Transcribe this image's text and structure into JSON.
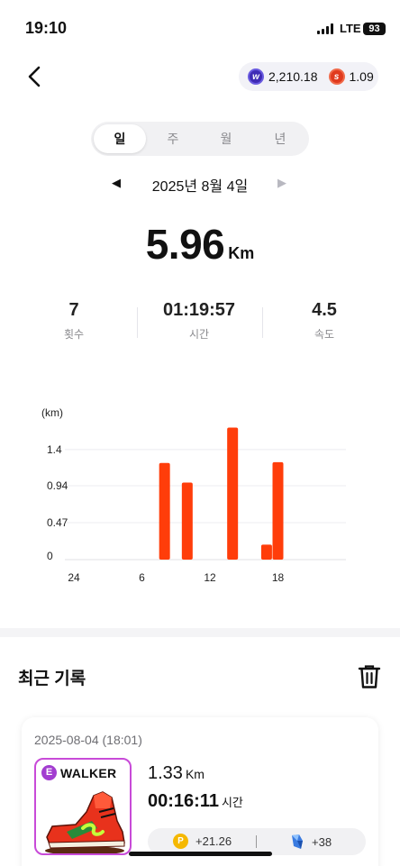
{
  "status_bar": {
    "time": "19:10",
    "network": "LTE",
    "battery": "93"
  },
  "header": {
    "balances": [
      {
        "icon": "w-token-icon",
        "value": "2,210.18",
        "color": "#3f2bb5"
      },
      {
        "icon": "s-token-icon",
        "value": "1.09",
        "color": "#e03a1e"
      }
    ]
  },
  "period_tabs": [
    "일",
    "주",
    "월",
    "년"
  ],
  "active_tab": "일",
  "date": {
    "label": "2025년 8월 4일",
    "prev_icon": "◀",
    "next_icon": "▶"
  },
  "summary": {
    "distance": "5.96",
    "distance_unit": "Km",
    "stats": [
      {
        "value": "7",
        "label": "횟수"
      },
      {
        "value": "01:19:57",
        "label": "시간"
      },
      {
        "value": "4.5",
        "label": "속도"
      }
    ]
  },
  "chart_data": {
    "type": "bar",
    "ylabel": "(km)",
    "y_ticks": [
      "0",
      "0.47",
      "0.94",
      "1.4"
    ],
    "x_ticks": [
      "24",
      "6",
      "12",
      "18"
    ],
    "xlim": [
      0,
      24
    ],
    "ylim": [
      0,
      1.41
    ],
    "grid": true,
    "bar_color": "#ff3d0a",
    "x": [
      8,
      10,
      14,
      17,
      18
    ],
    "values": [
      1.23,
      0.98,
      1.68,
      0.19,
      1.24
    ]
  },
  "recent": {
    "title": "최근 기록",
    "records": [
      {
        "datetime": "2025-08-04 (18:01)",
        "nft_grade": "E",
        "nft_name": "WALKER",
        "distance": "1.33",
        "distance_unit": "Km",
        "duration": "00:16:11",
        "duration_unit": "시간",
        "reward_points": "+21.26",
        "reward_gems": "+38"
      }
    ]
  }
}
